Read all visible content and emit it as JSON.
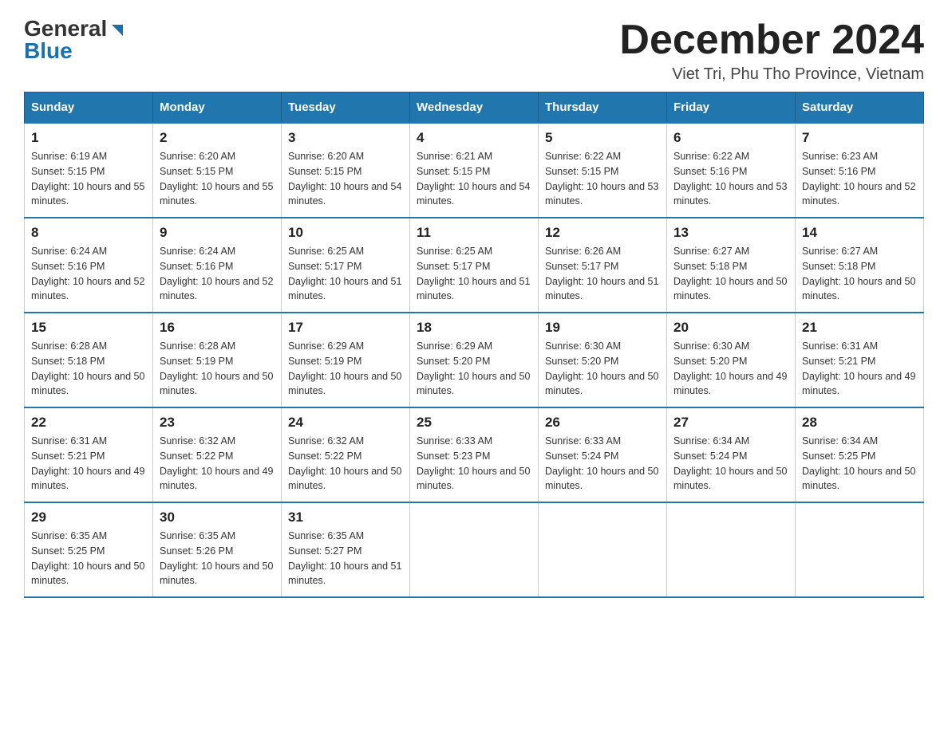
{
  "header": {
    "logo_general": "General",
    "logo_blue": "Blue",
    "month_title": "December 2024",
    "subtitle": "Viet Tri, Phu Tho Province, Vietnam"
  },
  "weekdays": [
    "Sunday",
    "Monday",
    "Tuesday",
    "Wednesday",
    "Thursday",
    "Friday",
    "Saturday"
  ],
  "weeks": [
    [
      {
        "day": "1",
        "sunrise": "6:19 AM",
        "sunset": "5:15 PM",
        "daylight": "10 hours and 55 minutes."
      },
      {
        "day": "2",
        "sunrise": "6:20 AM",
        "sunset": "5:15 PM",
        "daylight": "10 hours and 55 minutes."
      },
      {
        "day": "3",
        "sunrise": "6:20 AM",
        "sunset": "5:15 PM",
        "daylight": "10 hours and 54 minutes."
      },
      {
        "day": "4",
        "sunrise": "6:21 AM",
        "sunset": "5:15 PM",
        "daylight": "10 hours and 54 minutes."
      },
      {
        "day": "5",
        "sunrise": "6:22 AM",
        "sunset": "5:15 PM",
        "daylight": "10 hours and 53 minutes."
      },
      {
        "day": "6",
        "sunrise": "6:22 AM",
        "sunset": "5:16 PM",
        "daylight": "10 hours and 53 minutes."
      },
      {
        "day": "7",
        "sunrise": "6:23 AM",
        "sunset": "5:16 PM",
        "daylight": "10 hours and 52 minutes."
      }
    ],
    [
      {
        "day": "8",
        "sunrise": "6:24 AM",
        "sunset": "5:16 PM",
        "daylight": "10 hours and 52 minutes."
      },
      {
        "day": "9",
        "sunrise": "6:24 AM",
        "sunset": "5:16 PM",
        "daylight": "10 hours and 52 minutes."
      },
      {
        "day": "10",
        "sunrise": "6:25 AM",
        "sunset": "5:17 PM",
        "daylight": "10 hours and 51 minutes."
      },
      {
        "day": "11",
        "sunrise": "6:25 AM",
        "sunset": "5:17 PM",
        "daylight": "10 hours and 51 minutes."
      },
      {
        "day": "12",
        "sunrise": "6:26 AM",
        "sunset": "5:17 PM",
        "daylight": "10 hours and 51 minutes."
      },
      {
        "day": "13",
        "sunrise": "6:27 AM",
        "sunset": "5:18 PM",
        "daylight": "10 hours and 50 minutes."
      },
      {
        "day": "14",
        "sunrise": "6:27 AM",
        "sunset": "5:18 PM",
        "daylight": "10 hours and 50 minutes."
      }
    ],
    [
      {
        "day": "15",
        "sunrise": "6:28 AM",
        "sunset": "5:18 PM",
        "daylight": "10 hours and 50 minutes."
      },
      {
        "day": "16",
        "sunrise": "6:28 AM",
        "sunset": "5:19 PM",
        "daylight": "10 hours and 50 minutes."
      },
      {
        "day": "17",
        "sunrise": "6:29 AM",
        "sunset": "5:19 PM",
        "daylight": "10 hours and 50 minutes."
      },
      {
        "day": "18",
        "sunrise": "6:29 AM",
        "sunset": "5:20 PM",
        "daylight": "10 hours and 50 minutes."
      },
      {
        "day": "19",
        "sunrise": "6:30 AM",
        "sunset": "5:20 PM",
        "daylight": "10 hours and 50 minutes."
      },
      {
        "day": "20",
        "sunrise": "6:30 AM",
        "sunset": "5:20 PM",
        "daylight": "10 hours and 49 minutes."
      },
      {
        "day": "21",
        "sunrise": "6:31 AM",
        "sunset": "5:21 PM",
        "daylight": "10 hours and 49 minutes."
      }
    ],
    [
      {
        "day": "22",
        "sunrise": "6:31 AM",
        "sunset": "5:21 PM",
        "daylight": "10 hours and 49 minutes."
      },
      {
        "day": "23",
        "sunrise": "6:32 AM",
        "sunset": "5:22 PM",
        "daylight": "10 hours and 49 minutes."
      },
      {
        "day": "24",
        "sunrise": "6:32 AM",
        "sunset": "5:22 PM",
        "daylight": "10 hours and 50 minutes."
      },
      {
        "day": "25",
        "sunrise": "6:33 AM",
        "sunset": "5:23 PM",
        "daylight": "10 hours and 50 minutes."
      },
      {
        "day": "26",
        "sunrise": "6:33 AM",
        "sunset": "5:24 PM",
        "daylight": "10 hours and 50 minutes."
      },
      {
        "day": "27",
        "sunrise": "6:34 AM",
        "sunset": "5:24 PM",
        "daylight": "10 hours and 50 minutes."
      },
      {
        "day": "28",
        "sunrise": "6:34 AM",
        "sunset": "5:25 PM",
        "daylight": "10 hours and 50 minutes."
      }
    ],
    [
      {
        "day": "29",
        "sunrise": "6:35 AM",
        "sunset": "5:25 PM",
        "daylight": "10 hours and 50 minutes."
      },
      {
        "day": "30",
        "sunrise": "6:35 AM",
        "sunset": "5:26 PM",
        "daylight": "10 hours and 50 minutes."
      },
      {
        "day": "31",
        "sunrise": "6:35 AM",
        "sunset": "5:27 PM",
        "daylight": "10 hours and 51 minutes."
      },
      null,
      null,
      null,
      null
    ]
  ],
  "labels": {
    "sunrise": "Sunrise: ",
    "sunset": "Sunset: ",
    "daylight": "Daylight: "
  }
}
